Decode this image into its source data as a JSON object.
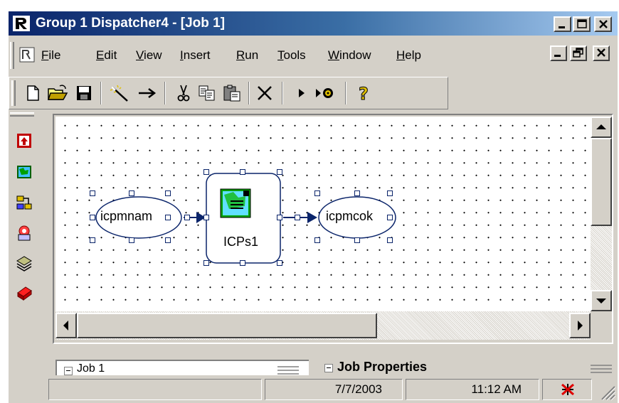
{
  "window": {
    "title": "Group 1 Dispatcher4 - [Job 1]",
    "title_bar_color": "#0a246a"
  },
  "menu": {
    "items": [
      "File",
      "Edit",
      "View",
      "Insert",
      "Run",
      "Tools",
      "Window",
      "Help"
    ],
    "underline": [
      "F",
      "E",
      "V",
      "I",
      "R",
      "T",
      "W",
      "H"
    ]
  },
  "toolbar": {
    "buttons": [
      "new-icon",
      "open-icon",
      "save-icon",
      "wizard-icon",
      "connect-arrow-icon",
      "cut-icon",
      "copy-icon",
      "paste-icon",
      "delete-icon",
      "run-icon",
      "run-debug-icon",
      "help-icon"
    ]
  },
  "palette": {
    "items": [
      "input-icon",
      "map-icon",
      "transform-icon",
      "process-icon",
      "stack-icon",
      "output-icon"
    ]
  },
  "diagram": {
    "nodes": {
      "input": {
        "label": "icpmnam",
        "shape": "ellipse"
      },
      "process": {
        "label": "ICPs1",
        "shape": "rounded-rect"
      },
      "output": {
        "label": "icpmcok",
        "shape": "ellipse"
      }
    },
    "edges": [
      [
        "input",
        "process"
      ],
      [
        "process",
        "output"
      ]
    ],
    "link_color": "#0a246a"
  },
  "panes": {
    "left": {
      "label": "Job 1"
    },
    "right": {
      "label": "Job Properties"
    }
  },
  "status": {
    "date": "7/7/2003",
    "time": "11:12 AM"
  }
}
